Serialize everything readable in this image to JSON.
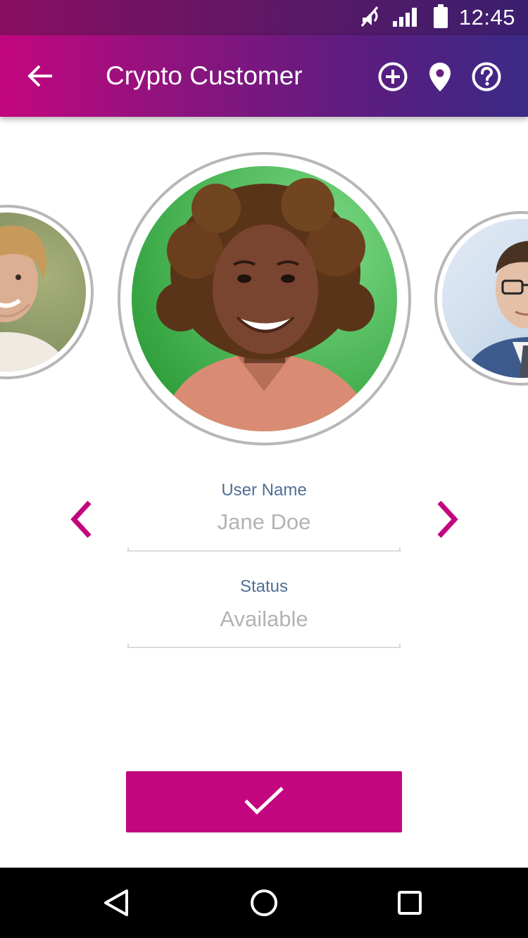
{
  "status_bar": {
    "time": "12:45",
    "icons": [
      "muted-icon",
      "signal-icon",
      "battery-icon"
    ]
  },
  "app_bar": {
    "title": "Crypto Customer",
    "back_icon": "arrow-left-icon",
    "actions": [
      "add-circle-icon",
      "location-pin-icon",
      "help-circle-icon"
    ]
  },
  "carousel": {
    "profiles": [
      {
        "position": "previous",
        "description": "curly-haired man smiling"
      },
      {
        "position": "current",
        "description": "smiling woman with curly hair on green background"
      },
      {
        "position": "next",
        "description": "man with glasses in suit"
      }
    ]
  },
  "form": {
    "user_name_label": "User Name",
    "user_name_value": "Jane Doe",
    "status_label": "Status",
    "status_value": "Available"
  },
  "navigation": {
    "prev_icon": "chevron-left-icon",
    "next_icon": "chevron-right-icon"
  },
  "confirm_button": {
    "icon": "check-icon"
  },
  "system_nav": [
    "back-triangle-icon",
    "home-circle-icon",
    "recents-square-icon"
  ],
  "colors": {
    "accent": "#c3067f",
    "label_blue": "#4f6e96",
    "value_gray": "#b3b3b3"
  }
}
